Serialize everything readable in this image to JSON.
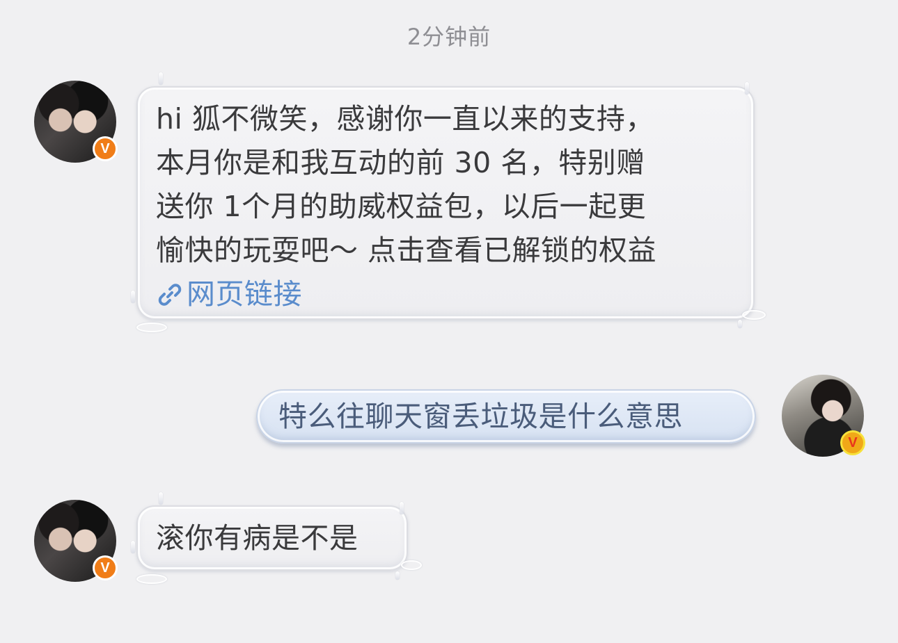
{
  "timestamp": "2分钟前",
  "messages": [
    {
      "side": "left",
      "sender_badge": "V",
      "lines": [
        "hi 狐不微笑，感谢你一直以来的支持，",
        "本月你是和我互动的前 30 名，特别赠",
        "送你 1个月的助威权益包，以后一起更",
        "愉快的玩耍吧～ 点击查看已解锁的权益"
      ],
      "link_icon": "link-icon",
      "link_label": "网页链接"
    },
    {
      "side": "right",
      "sender_badge": "V",
      "text": "特么往聊天窗丢垃圾是什么意思"
    },
    {
      "side": "left",
      "sender_badge": "V",
      "text": "滚你有病是不是"
    }
  ],
  "colors": {
    "background": "#f0f0f2",
    "link": "#5a8ccc",
    "badge_orange": "#f07d18",
    "badge_gold": "#f0a818",
    "outgoing_text": "#4a5c7a"
  }
}
